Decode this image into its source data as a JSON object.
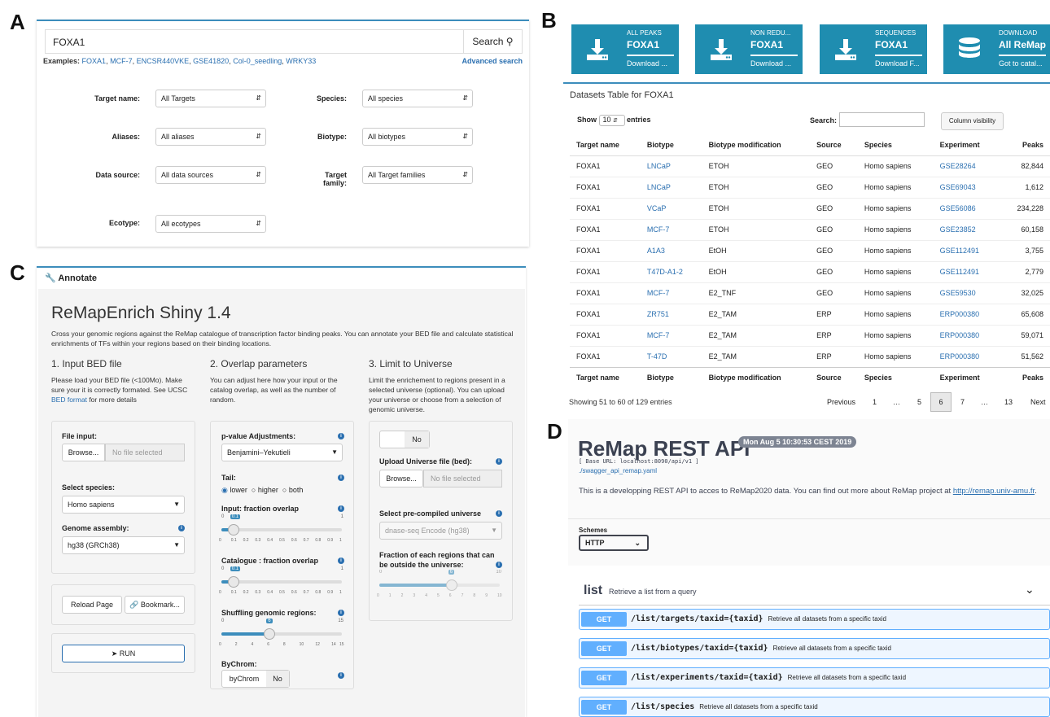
{
  "labels": {
    "a": "A",
    "b": "B",
    "c": "C",
    "d": "D"
  },
  "panelA": {
    "search_value": "FOXA1",
    "search_button": "Search",
    "examples_label": "Examples:",
    "examples": [
      "FOXA1",
      "MCF-7",
      "ENCSR440VKE",
      "GSE41820",
      "Col-0_seedling",
      "WRKY33"
    ],
    "advanced": "Advanced search",
    "filters": [
      {
        "label": "Target name:",
        "value": "All Targets"
      },
      {
        "label": "Species:",
        "value": "All species"
      },
      {
        "label": "Aliases:",
        "value": "All aliases"
      },
      {
        "label": "Biotype:",
        "value": "All biotypes"
      },
      {
        "label": "Data source:",
        "value": "All data sources"
      },
      {
        "label": "Target family:",
        "value": "All Target families"
      },
      {
        "label": "Ecotype:",
        "value": "All ecotypes"
      }
    ]
  },
  "panelB": {
    "tiles": [
      {
        "top": "ALL PEAKS",
        "name": "FOXA1",
        "action": "Download ..."
      },
      {
        "top": "NON REDU...",
        "name": "FOXA1",
        "action": "Download ..."
      },
      {
        "top": "SEQUENCES",
        "name": "FOXA1",
        "action": "Download F..."
      },
      {
        "top": "DOWNLOAD",
        "name": "All ReMap",
        "action": "Got to catal..."
      }
    ],
    "table_title": "Datasets Table for FOXA1",
    "show": "Show",
    "entries_value": "10",
    "entries": "entries",
    "search_label": "Search:",
    "colvis": "Column visibility",
    "columns": [
      "Target name",
      "Biotype",
      "Biotype modification",
      "Source",
      "Species",
      "Experiment",
      "Peaks"
    ],
    "rows": [
      [
        "FOXA1",
        "LNCaP",
        "ETOH",
        "GEO",
        "Homo sapiens",
        "GSE28264",
        "82,844"
      ],
      [
        "FOXA1",
        "LNCaP",
        "ETOH",
        "GEO",
        "Homo sapiens",
        "GSE69043",
        "1,612"
      ],
      [
        "FOXA1",
        "VCaP",
        "ETOH",
        "GEO",
        "Homo sapiens",
        "GSE56086",
        "234,228"
      ],
      [
        "FOXA1",
        "MCF-7",
        "ETOH",
        "GEO",
        "Homo sapiens",
        "GSE23852",
        "60,158"
      ],
      [
        "FOXA1",
        "A1A3",
        "EtOH",
        "GEO",
        "Homo sapiens",
        "GSE112491",
        "3,755"
      ],
      [
        "FOXA1",
        "T47D-A1-2",
        "EtOH",
        "GEO",
        "Homo sapiens",
        "GSE112491",
        "2,779"
      ],
      [
        "FOXA1",
        "MCF-7",
        "E2_TNF",
        "GEO",
        "Homo sapiens",
        "GSE59530",
        "32,025"
      ],
      [
        "FOXA1",
        "ZR751",
        "E2_TAM",
        "ERP",
        "Homo sapiens",
        "ERP000380",
        "65,608"
      ],
      [
        "FOXA1",
        "MCF-7",
        "E2_TAM",
        "ERP",
        "Homo sapiens",
        "ERP000380",
        "59,071"
      ],
      [
        "FOXA1",
        "T-47D",
        "E2_TAM",
        "ERP",
        "Homo sapiens",
        "ERP000380",
        "51,562"
      ]
    ],
    "info": "Showing 51 to 60 of 129 entries",
    "pages": [
      "Previous",
      "1",
      "…",
      "5",
      "6",
      "7",
      "…",
      "13",
      "Next"
    ]
  },
  "panelC": {
    "header": "Annotate",
    "title": "ReMapEnrich Shiny 1.4",
    "intro": "Cross your genomic regions against the ReMap catalogue of transcription factor binding peaks. You can annotate your BED file and calculate statistical enrichments of TFs within your regions based on their binding locations.",
    "s1_title": "1. Input BED file",
    "s1_text": "Please load your BED file (<100Mo). Make sure your it is correctly formated. See UCSC",
    "s1_link": "BED format",
    "s1_tail": "for more details",
    "s2_title": "2. Overlap parameters",
    "s2_text": "You can adjust here how your input or the catalog overlap, as well as the number of random.",
    "s3_title": "3. Limit to Universe",
    "s3_text": "Limit the enrichement to regions present in a selected universe (optional). You can upload your universe or choose from a selection of genomic universe.",
    "file_input": "File input:",
    "browse": "Browse...",
    "no_file": "No file selected",
    "select_species": "Select species:",
    "species": "Homo sapiens",
    "genome_assembly": "Genome assembly:",
    "genome": "hg38 (GRCh38)",
    "reload": "Reload Page",
    "bookmark": "Bookmark...",
    "run": "RUN",
    "pval_label": "p-value Adjustments:",
    "pval": "Benjamini–Yekutieli",
    "tail": "Tail:",
    "tail_opts": [
      "lower",
      "higher",
      "both"
    ],
    "input_overlap": "Input: fraction overlap",
    "input_overlap_value": 0.1,
    "cat_overlap": "Catalogue : fraction overlap",
    "cat_overlap_value": 0.1,
    "shuffle": "Shuffling genomic regions:",
    "shuffle_value": 6,
    "shuffle_max": 15,
    "bychrom": "ByChrom:",
    "bychrom_opt": "byChrom",
    "no": "No",
    "universe_toggle": "No",
    "upload_universe": "Upload Universe file (bed):",
    "precompiled": "Select pre-compiled universe",
    "precompiled_value": "dnase-seq Encode (hg38)",
    "fraction_outside": "Fraction of each regions that can be outside the universe:",
    "fraction_outside_value": 6,
    "fraction_outside_max": 10,
    "ticks01": [
      "0",
      "0.1",
      "0.2",
      "0.3",
      "0.4",
      "0.5",
      "0.6",
      "0.7",
      "0.8",
      "0.9",
      "1"
    ],
    "ticks15": [
      "0",
      "2",
      "4",
      "6",
      "8",
      "10",
      "12",
      "14",
      "15"
    ],
    "ticks10": [
      "0",
      "1",
      "2",
      "3",
      "4",
      "5",
      "6",
      "7",
      "8",
      "9",
      "10"
    ]
  },
  "panelD": {
    "title": "ReMap REST API",
    "date": "Mon Aug 5 10:30:53 CEST 2019",
    "base": "[ Base URL: localhost:8090/api/v1 ]",
    "yaml": "./swagger_api_remap.yaml",
    "desc": "This is a developping REST API to acces to ReMap2020 data. You can find out more about ReMap project at",
    "link": "http://remap.univ-amu.fr",
    "schemes": "Schemes",
    "scheme_value": "HTTP",
    "section": "list",
    "section_desc": "Retrieve a list from a query",
    "endpoints": [
      {
        "method": "GET",
        "path": "/list/targets/taxid={taxid}",
        "desc": "Retrieve all datasets from a specific taxid"
      },
      {
        "method": "GET",
        "path": "/list/biotypes/taxid={taxid}",
        "desc": "Retrieve all datasets from a specific taxid"
      },
      {
        "method": "GET",
        "path": "/list/experiments/taxid={taxid}",
        "desc": "Retrieve all datasets from a specific taxid"
      },
      {
        "method": "GET",
        "path": "/list/species",
        "desc": "Retrieve all datasets from a specific taxid"
      }
    ]
  },
  "colors": {
    "accent": "#1f8db0",
    "border": "#3c8dbc",
    "get": "#61affe"
  }
}
